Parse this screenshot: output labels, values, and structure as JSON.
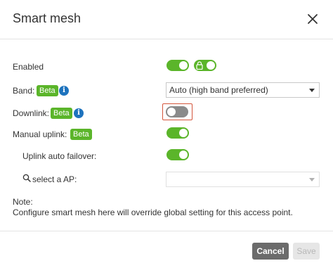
{
  "dialog": {
    "title": "Smart mesh",
    "close_icon": "close-icon"
  },
  "form": {
    "enabled": {
      "label": "Enabled",
      "value": "on",
      "locked_toggle": "on"
    },
    "band": {
      "label": "Band:",
      "badge": "Beta",
      "info_icon": "info-icon",
      "info_glyph": "i",
      "selected": "Auto (high band preferred)"
    },
    "downlink": {
      "label": "Downlink:",
      "badge": "Beta",
      "info_icon": "info-icon",
      "info_glyph": "i",
      "value": "off"
    },
    "manual_uplink": {
      "label": "Manual uplink:",
      "badge": "Beta",
      "value": "on"
    },
    "uplink_auto_failover": {
      "label": "Uplink auto failover:",
      "value": "on"
    },
    "select_ap": {
      "label": "select a AP:",
      "icon": "search-icon",
      "selected": ""
    }
  },
  "note": {
    "title": "Note:",
    "text": "Configure smart mesh here will override global setting for this access point."
  },
  "footer": {
    "cancel_label": "Cancel",
    "save_label": "Save"
  },
  "colors": {
    "toggle_on": "#5bb52a",
    "toggle_off": "#8a8a8a",
    "badge": "#5bb52a",
    "info": "#1e73be",
    "highlight": "#d4553b",
    "cancel_button": "#6b6b6b",
    "save_button_disabled": "#e6e6e6"
  }
}
